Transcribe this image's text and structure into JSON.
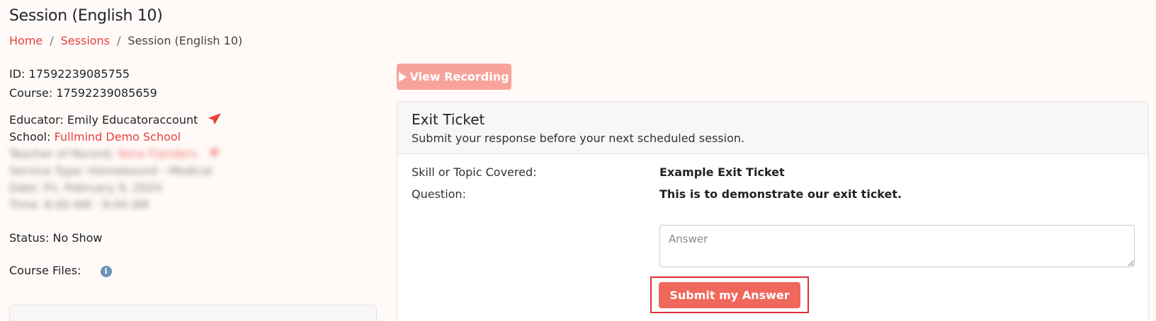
{
  "page": {
    "title": "Session (English 10)"
  },
  "breadcrumb": {
    "home": "Home",
    "sessions": "Sessions",
    "current": "Session (English 10)",
    "separator": "/"
  },
  "session_info": {
    "id_label": "ID:",
    "id_value": "17592239085755",
    "course_label": "Course:",
    "course_value": "17592239085659",
    "educator_label": "Educator:",
    "educator_value": "Emily Educatoraccount",
    "school_label": "School:",
    "school_value": "Fullmind Demo School",
    "teacher_label": "Teacher of Record:",
    "teacher_value": "Nora Flanders",
    "service_type": "Service Type: Homebound - Medical",
    "date": "Date: Fri, February 9, 2024",
    "time": "Time: 8:00 AM - 9:00 AM",
    "status_label": "Status:",
    "status_value": "No Show",
    "course_files_label": "Course Files:",
    "info_glyph": "i"
  },
  "actions": {
    "view_recording_label": "View Recording"
  },
  "exit_ticket": {
    "title": "Exit Ticket",
    "subtitle": "Submit your response before your next scheduled session.",
    "skill_label": "Skill or Topic Covered:",
    "skill_value": "Example Exit Ticket",
    "question_label": "Question:",
    "question_value": "This is to demonstrate our exit ticket.",
    "answer_placeholder": "Answer",
    "submit_label": "Submit my Answer"
  },
  "colors": {
    "accent": "#e5403e",
    "button_primary": "#f0675b",
    "button_disabled": "#f7a39b",
    "highlight_border": "#e0303a",
    "info_icon": "#6a93b8"
  },
  "icons": {
    "play": "play-icon",
    "send": "paper-plane-icon",
    "info": "info-icon"
  }
}
